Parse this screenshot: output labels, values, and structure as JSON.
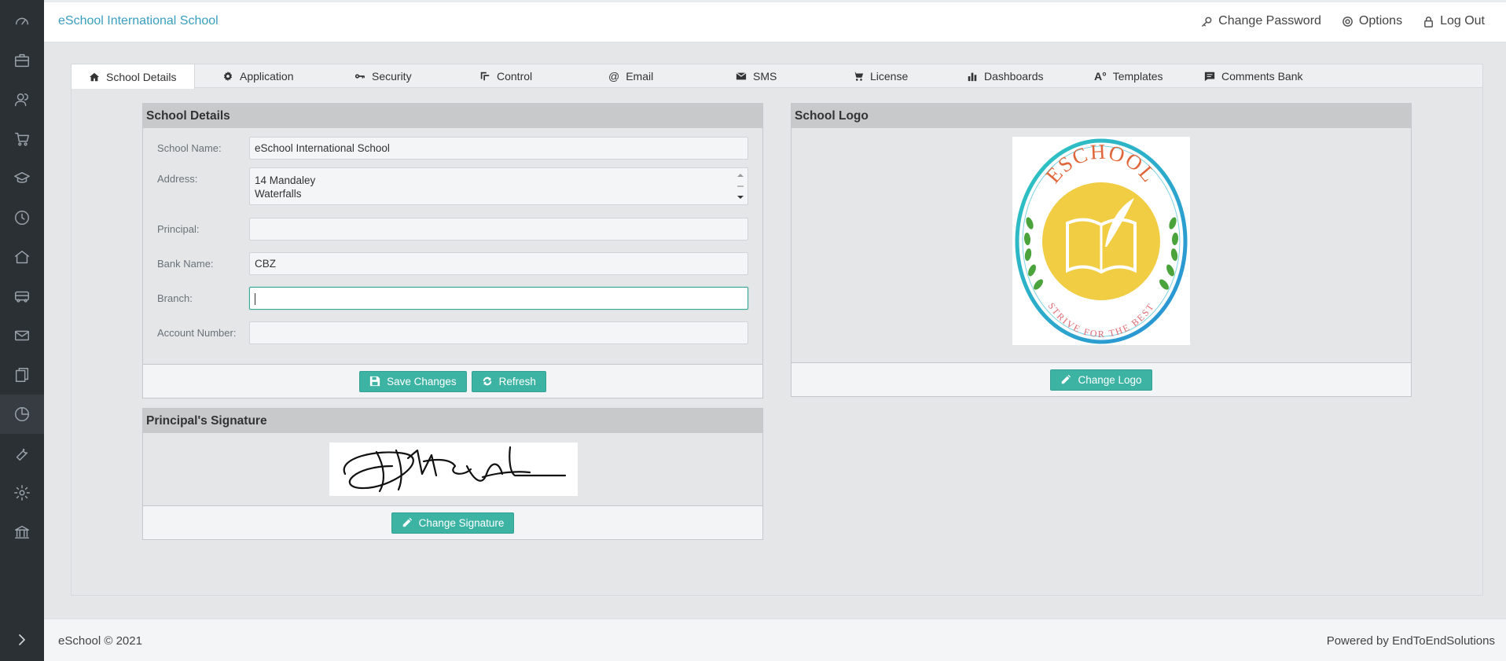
{
  "header": {
    "brand": "eSchool International School",
    "links": {
      "change_password": "Change Password",
      "options": "Options",
      "logout": "Log Out"
    }
  },
  "tabs": [
    {
      "label": "School Details",
      "icon": "home-icon",
      "active": true
    },
    {
      "label": "Application",
      "icon": "gear-icon"
    },
    {
      "label": "Security",
      "icon": "key-icon"
    },
    {
      "label": "Control",
      "icon": "control-icon"
    },
    {
      "label": "Email",
      "icon": "at-icon"
    },
    {
      "label": "SMS",
      "icon": "envelope-icon"
    },
    {
      "label": "License",
      "icon": "cart-icon"
    },
    {
      "label": "Dashboards",
      "icon": "bar-chart-icon"
    },
    {
      "label": "Templates",
      "icon": "font-icon"
    },
    {
      "label": "Comments Bank",
      "icon": "comment-icon"
    }
  ],
  "school_details": {
    "title": "School Details",
    "fields": {
      "school_name": {
        "label": "School Name:",
        "value": "eSchool International School"
      },
      "address": {
        "label": "Address:",
        "line1": "14 Mandaley",
        "line2": "Waterfalls"
      },
      "principal": {
        "label": "Principal:",
        "value": ""
      },
      "bank_name": {
        "label": "Bank Name:",
        "value": "CBZ"
      },
      "branch": {
        "label": "Branch:",
        "value": ""
      },
      "account_number": {
        "label": "Account Number:",
        "value": ""
      }
    },
    "save_label": "Save Changes",
    "refresh_label": "Refresh"
  },
  "school_logo": {
    "title": "School Logo",
    "logo_text_top": "ESCHOOL",
    "logo_text_bottom": "STRIVE FOR THE BEST",
    "change_label": "Change Logo"
  },
  "signature": {
    "title": "Principal's Signature",
    "change_label": "Change Signature"
  },
  "footer": {
    "left": "eSchool © 2021",
    "right": "Powered by EndToEndSolutions"
  },
  "colors": {
    "accent": "#3db3a4",
    "brand": "#3a9fbf",
    "sidebar": "#2b3035"
  }
}
